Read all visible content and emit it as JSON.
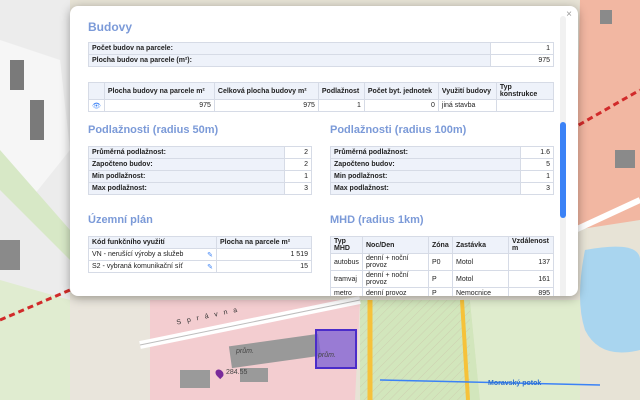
{
  "map": {
    "labels": {
      "prum_1": "prům.",
      "prum_2": "prům.",
      "elevation": "284.55",
      "street": "S p r á v n a",
      "river": "Moravský potok"
    }
  },
  "popup": {
    "close_label": "×",
    "budovy": {
      "title": "Budovy",
      "summary": [
        {
          "label": "Počet budov na parcele:",
          "value": "1"
        },
        {
          "label": "Plocha budov na parcele (m²):",
          "value": "975"
        }
      ],
      "columns": [
        "",
        "Plocha budovy na parcele m²",
        "Celková plocha budovy m²",
        "Podlažnost",
        "Počet byt. jednotek",
        "Využití budovy",
        "Typ konstrukce"
      ],
      "rows": [
        {
          "plocha": "975",
          "celkova": "975",
          "podlaznost": "1",
          "byty": "0",
          "vyuziti": "jiná stavba",
          "typ": ""
        }
      ]
    },
    "podlaznost_50": {
      "title": "Podlažnosti (radius 50m)",
      "rows": [
        {
          "label": "Průměrná podlažnost:",
          "value": "2"
        },
        {
          "label": "Započteno budov:",
          "value": "2"
        },
        {
          "label": "Min podlažnost:",
          "value": "1"
        },
        {
          "label": "Max podlažnost:",
          "value": "3"
        }
      ]
    },
    "podlaznost_100": {
      "title": "Podlažnosti (radius 100m)",
      "rows": [
        {
          "label": "Průměrná podlažnost:",
          "value": "1.6"
        },
        {
          "label": "Započteno budov:",
          "value": "5"
        },
        {
          "label": "Min podlažnost:",
          "value": "1"
        },
        {
          "label": "Max podlažnost:",
          "value": "3"
        }
      ]
    },
    "uzemni_plan": {
      "title": "Územní plán",
      "columns": [
        "Kód funkčního využití",
        "Plocha na parcele m²"
      ],
      "rows": [
        {
          "kod": "VN - nerušící výroby a služeb",
          "plocha": "1 519"
        },
        {
          "kod": "S2 - vybraná komunikační síť",
          "plocha": "15"
        }
      ]
    },
    "mhd": {
      "title": "MHD (radius 1km)",
      "columns": [
        "Typ MHD",
        "Noc/Den",
        "Zóna",
        "Zastávka",
        "Vzdálenost m"
      ],
      "rows": [
        {
          "typ": "autobus",
          "noc": "denní + noční provoz",
          "zona": "P0",
          "zastavka": "Motol",
          "vzd": "137"
        },
        {
          "typ": "tramvaj",
          "noc": "denní + noční provoz",
          "zona": "P",
          "zastavka": "Motol",
          "vzd": "161"
        },
        {
          "typ": "metro",
          "noc": "denní provoz",
          "zona": "P",
          "zastavka": "Nemocnice",
          "vzd": "895"
        }
      ]
    }
  }
}
